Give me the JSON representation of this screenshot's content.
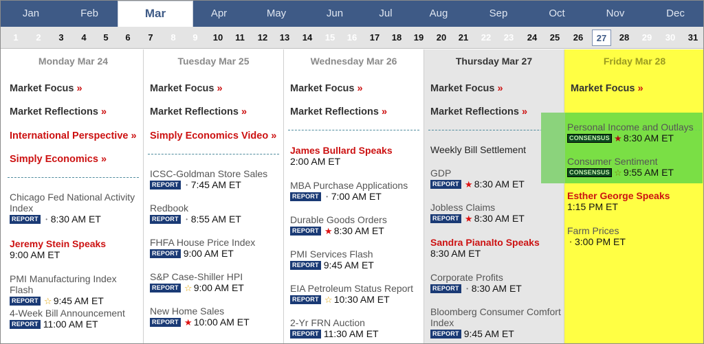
{
  "months": [
    "Jan",
    "Feb",
    "Mar",
    "Apr",
    "May",
    "Jun",
    "Jul",
    "Aug",
    "Sep",
    "Oct",
    "Nov",
    "Dec"
  ],
  "active_month": "Mar",
  "days": [
    "1",
    "2",
    "3",
    "4",
    "5",
    "6",
    "7",
    "8",
    "9",
    "10",
    "11",
    "12",
    "13",
    "14",
    "15",
    "16",
    "17",
    "18",
    "19",
    "20",
    "21",
    "22",
    "23",
    "24",
    "25",
    "26",
    "27",
    "28",
    "29",
    "30",
    "31"
  ],
  "weekend_days": [
    "1",
    "2",
    "8",
    "9",
    "15",
    "16",
    "22",
    "23",
    "29",
    "30"
  ],
  "today": "27",
  "columns": {
    "mon": {
      "header": "Monday Mar 24",
      "links": [
        "Market Focus",
        "Market Reflections",
        "International Perspective",
        "Simply Economics"
      ],
      "arrow": "»",
      "events": [
        {
          "title": "Chicago Fed National Activity",
          "title2": "Index",
          "badge": "REPORT",
          "mark": "•",
          "time": "8:30 AM ET"
        },
        {
          "title": "Jeremy Stein Speaks",
          "time": "9:00 AM ET"
        },
        {
          "title": "PMI Manufacturing Index Flash",
          "badge": "REPORT",
          "mark": "☆",
          "time": "9:45 AM ET"
        },
        {
          "title": "4-Week Bill Announcement",
          "badge": "REPORT",
          "time": "11:00 AM ET"
        }
      ]
    },
    "tue": {
      "header": "Tuesday Mar 25",
      "links": [
        "Market Focus",
        "Market Reflections",
        "Simply Economics Video"
      ],
      "events": [
        {
          "title": "ICSC-Goldman Store Sales",
          "badge": "REPORT",
          "mark": "•",
          "time": "7:45 AM ET"
        },
        {
          "title": "Redbook",
          "badge": "REPORT",
          "mark": "•",
          "time": "8:55 AM ET"
        },
        {
          "title": "FHFA House Price Index",
          "badge": "REPORT",
          "time": "9:00 AM ET"
        },
        {
          "title": "S&P Case-Shiller HPI",
          "badge": "REPORT",
          "mark": "☆",
          "time": "9:00 AM ET"
        },
        {
          "title": "New Home Sales",
          "badge": "REPORT",
          "mark": "★",
          "time": "10:00 AM ET"
        }
      ]
    },
    "wed": {
      "header": "Wednesday Mar 26",
      "links": [
        "Market Focus",
        "Market Reflections"
      ],
      "events": [
        {
          "title": "James Bullard Speaks",
          "time": "2:00 AM ET"
        },
        {
          "title": "MBA Purchase Applications",
          "badge": "REPORT",
          "mark": "•",
          "time": "7:00 AM ET"
        },
        {
          "title": "Durable Goods Orders",
          "badge": "REPORT",
          "mark": "★",
          "time": "8:30 AM ET"
        },
        {
          "title": "PMI Services Flash",
          "badge": "REPORT",
          "time": "9:45 AM ET"
        },
        {
          "title": "EIA Petroleum Status Report",
          "badge": "REPORT",
          "mark": "☆",
          "time": "10:30 AM ET"
        },
        {
          "title": "2-Yr FRN Auction",
          "badge": "REPORT",
          "time": "11:30 AM ET"
        }
      ]
    },
    "thu": {
      "header": "Thursday Mar 27",
      "links": [
        "Market Focus",
        "Market Reflections"
      ],
      "events": [
        {
          "title": "Weekly Bill Settlement"
        },
        {
          "title": "GDP",
          "badge": "REPORT",
          "mark": "★",
          "time": "8:30 AM ET"
        },
        {
          "title": "Jobless Claims",
          "badge": "REPORT",
          "mark": "★",
          "time": "8:30 AM ET"
        },
        {
          "title": "Sandra Pianalto Speaks",
          "time": "8:30 AM ET"
        },
        {
          "title": "Corporate Profits",
          "badge": "REPORT",
          "mark": "•",
          "time": "8:30 AM ET"
        },
        {
          "title": "Bloomberg Consumer Comfort",
          "title2": "Index",
          "badge": "REPORT",
          "time": "9:45 AM ET"
        }
      ]
    },
    "fri": {
      "header": "Friday Mar 28",
      "links": [
        "Market Focus"
      ],
      "events": [
        {
          "title": "Personal Income and Outlays",
          "badge": "CONSENSUS",
          "mark": "★",
          "time": "8:30 AM ET"
        },
        {
          "title": "Consumer Sentiment",
          "badge": "CONSENSUS",
          "mark": "☆",
          "time": "9:55 AM ET"
        },
        {
          "title": "Esther George Speaks",
          "time": "1:15 PM ET"
        },
        {
          "title": "Farm Prices",
          "mark": "•",
          "time": "3:00 PM ET"
        }
      ]
    }
  },
  "colors": {
    "month_bar": "#3e5a86",
    "link_red": "#cc1111",
    "report_badge": "#1a3a75",
    "friday_bg": "#ffff44",
    "thursday_bg": "#e6e6e6",
    "highlight": "#6fdc45"
  }
}
